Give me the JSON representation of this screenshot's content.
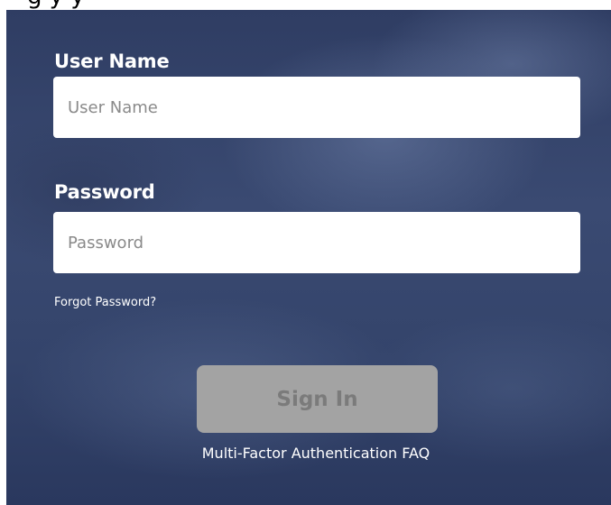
{
  "top_strip": {
    "text": "g  y     y"
  },
  "form": {
    "username": {
      "label": "User Name",
      "placeholder": "User Name",
      "value": ""
    },
    "password": {
      "label": "Password",
      "placeholder": "Password",
      "value": ""
    },
    "forgot_password_link": "Forgot Password?",
    "sign_in_button": "Sign In",
    "mfa_faq_link": "Multi-Factor Authentication FAQ"
  },
  "colors": {
    "panel_background": "#34446b",
    "label_text": "#ffffff",
    "input_background": "#ffffff",
    "placeholder_text": "#8a8a8a",
    "button_background": "#a3a3a3",
    "button_text": "#7b7b7b"
  }
}
